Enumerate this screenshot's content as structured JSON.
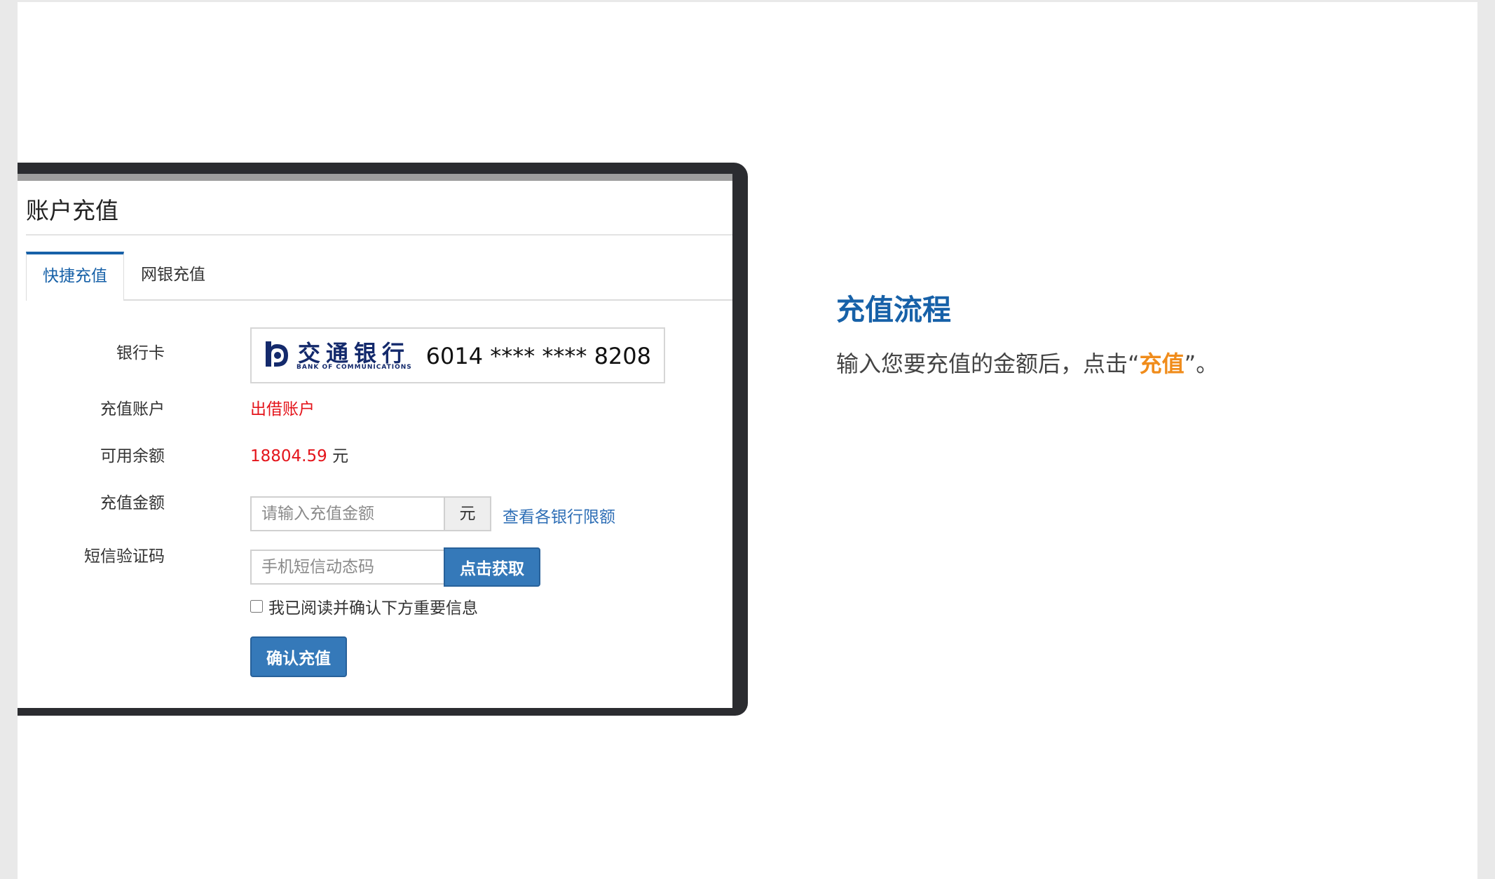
{
  "screen": {
    "title": "账户充值",
    "tabs": [
      {
        "label": "快捷充值",
        "active": true
      },
      {
        "label": "网银充值",
        "active": false
      }
    ]
  },
  "form": {
    "bank_card_label": "银行卡",
    "bank": {
      "name_cn": "交通银行",
      "name_en": "BANK OF COMMUNICATIONS",
      "card_number": "6014 **** **** 8208",
      "logo_icon": "bank-of-communications-logo"
    },
    "account_label": "充值账户",
    "account_value": "出借账户",
    "balance_label": "可用余额",
    "balance_value": "18804.59",
    "balance_unit": "元",
    "amount_label": "充值金额",
    "amount_placeholder": "请输入充值金额",
    "amount_unit": "元",
    "limit_link": "查看各银行限额",
    "sms_label": "短信验证码",
    "sms_placeholder": "手机短信动态码",
    "sms_button": "点击获取",
    "agree_text": "我已阅读并确认下方重要信息",
    "confirm_button": "确认充值"
  },
  "side": {
    "title": "充值流程",
    "desc_before": "输入您要充值的金额后，点击“",
    "desc_highlight": "充值",
    "desc_after": "”。"
  },
  "colors": {
    "accent_blue": "#1761a8",
    "button_blue": "#3579b9",
    "link_blue": "#2f6fb6",
    "alert_red": "#e4141b",
    "highlight_orange": "#f08c1b",
    "frame_dark": "#2b2c30"
  }
}
